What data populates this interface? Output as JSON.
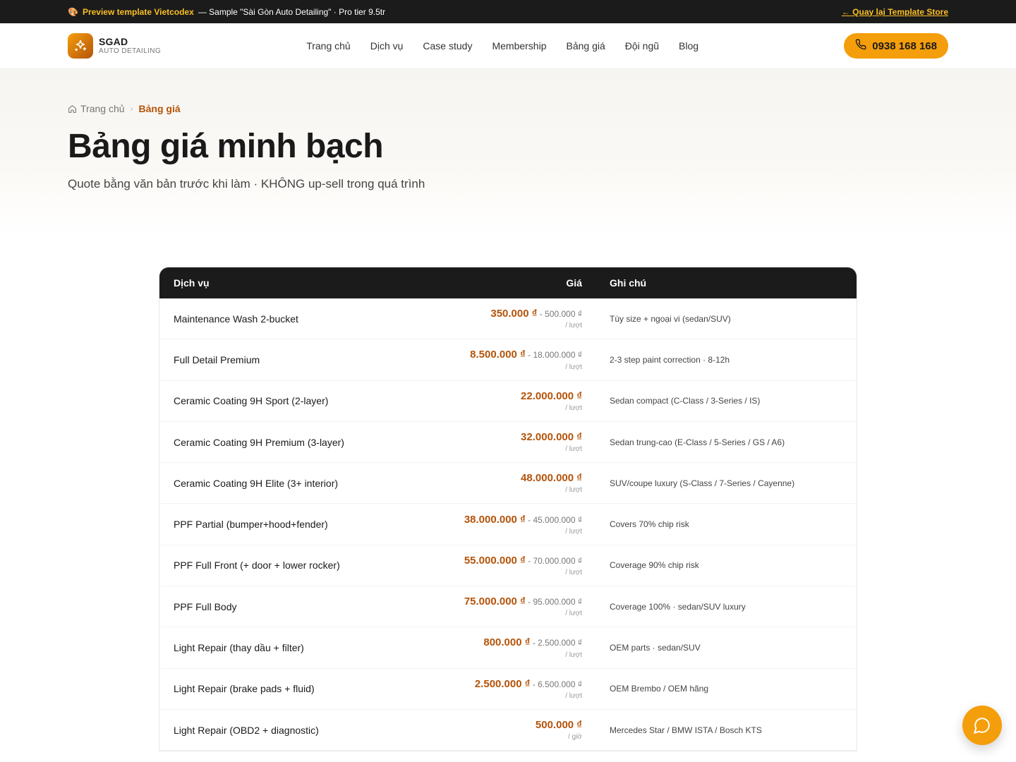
{
  "topbar": {
    "palette_icon": "palette-icon",
    "brand": "Preview template Vietcodex",
    "tagline": "— Sample \"Sài Gòn Auto Detailing\" · Pro tier 9.5tr",
    "back_link": "← Quay lại Template Store"
  },
  "header": {
    "logo_name": "SGAD",
    "logo_sub": "AUTO DETAILING",
    "nav": [
      "Trang chủ",
      "Dịch vụ",
      "Case study",
      "Membership",
      "Bảng giá",
      "Đội ngũ",
      "Blog"
    ],
    "phone": "0938 168 168"
  },
  "hero": {
    "breadcrumb_home": "Trang chủ",
    "breadcrumb_current": "Bảng giá",
    "title": "Bảng giá minh bạch",
    "subtitle": "Quote bằng văn bản trước khi làm · KHÔNG up-sell trong quá trình"
  },
  "table": {
    "headers": {
      "service": "Dịch vụ",
      "price": "Giá",
      "note": "Ghi chú"
    },
    "rows": [
      {
        "service": "Maintenance Wash 2-bucket",
        "price": "350.000 ₫",
        "max": " - 500.000 ₫",
        "unit": "/ lượt",
        "note": "Tùy size + ngoại vi (sedan/SUV)"
      },
      {
        "service": "Full Detail Premium",
        "price": "8.500.000 ₫",
        "max": " - 18.000.000 ₫",
        "unit": "/ lượt",
        "note": "2-3 step paint correction · 8-12h"
      },
      {
        "service": "Ceramic Coating 9H Sport (2-layer)",
        "price": "22.000.000 ₫",
        "max": "",
        "unit": "/ lượt",
        "note": "Sedan compact (C-Class / 3-Series / IS)"
      },
      {
        "service": "Ceramic Coating 9H Premium (3-layer)",
        "price": "32.000.000 ₫",
        "max": "",
        "unit": "/ lượt",
        "note": "Sedan trung-cao (E-Class / 5-Series / GS / A6)"
      },
      {
        "service": "Ceramic Coating 9H Elite (3+ interior)",
        "price": "48.000.000 ₫",
        "max": "",
        "unit": "/ lượt",
        "note": "SUV/coupe luxury (S-Class / 7-Series / Cayenne)"
      },
      {
        "service": "PPF Partial (bumper+hood+fender)",
        "price": "38.000.000 ₫",
        "max": " - 45.000.000 ₫",
        "unit": "/ lượt",
        "note": "Covers 70% chip risk"
      },
      {
        "service": "PPF Full Front (+ door + lower rocker)",
        "price": "55.000.000 ₫",
        "max": " - 70.000.000 ₫",
        "unit": "/ lượt",
        "note": "Coverage 90% chip risk"
      },
      {
        "service": "PPF Full Body",
        "price": "75.000.000 ₫",
        "max": " - 95.000.000 ₫",
        "unit": "/ lượt",
        "note": "Coverage 100% · sedan/SUV luxury"
      },
      {
        "service": "Light Repair (thay dầu + filter)",
        "price": "800.000 ₫",
        "max": " - 2.500.000 ₫",
        "unit": "/ lượt",
        "note": "OEM parts · sedan/SUV"
      },
      {
        "service": "Light Repair (brake pads + fluid)",
        "price": "2.500.000 ₫",
        "max": " - 6.500.000 ₫",
        "unit": "/ lượt",
        "note": "OEM Brembo / OEM hãng"
      },
      {
        "service": "Light Repair (OBD2 + diagnostic)",
        "price": "500.000 ₫",
        "max": "",
        "unit": "/ giờ",
        "note": "Mercedes Star / BMW ISTA / Bosch KTS"
      }
    ]
  },
  "colors": {
    "accent": "#f59e0b",
    "price": "#b45309",
    "dark": "#1b1b1b"
  },
  "chat_icon": "chat-bubble-icon"
}
